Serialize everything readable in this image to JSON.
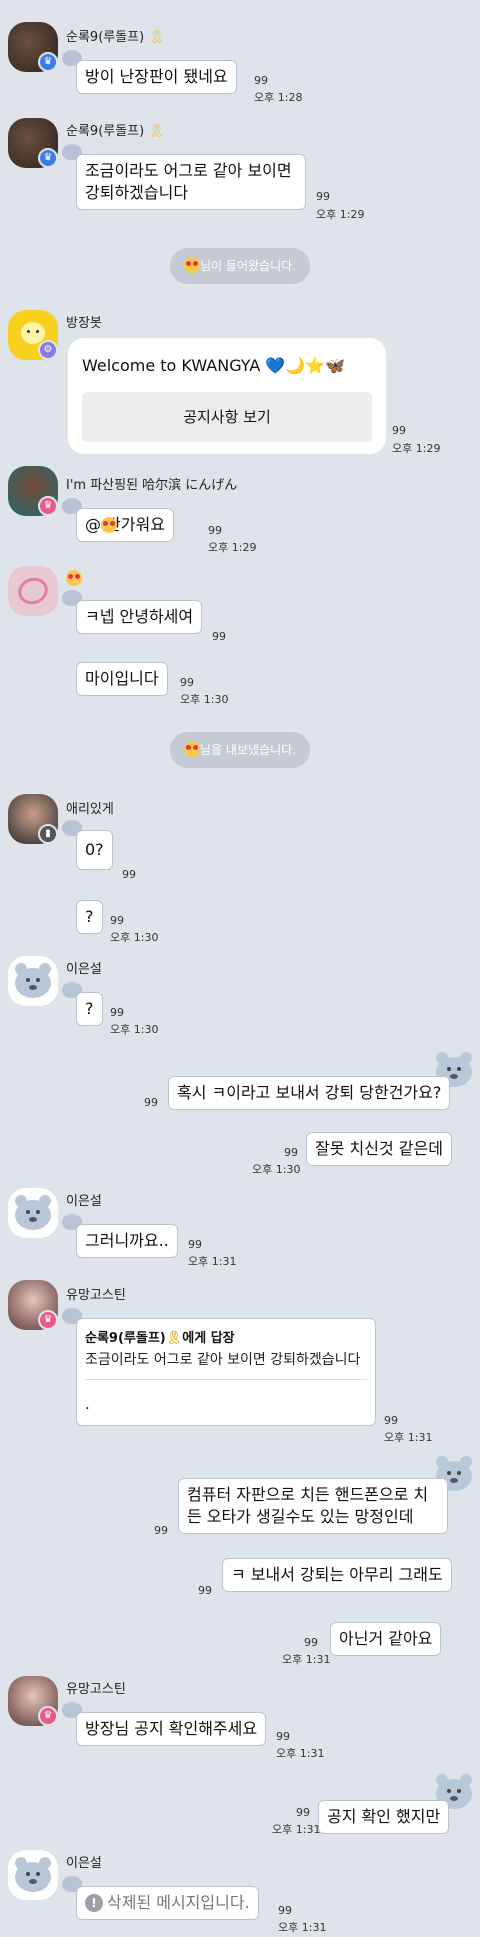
{
  "read_count": "99",
  "messages": {
    "m1": {
      "sender": "순록9(루돌프)",
      "text": "방이 난장판이 됐네요",
      "time": "오후 1:28"
    },
    "m2": {
      "sender": "순록9(루돌프)",
      "text": "조금이라도 어그로 같아 보이면 강퇴하겠습니다",
      "time": "오후 1:29"
    },
    "sys1": {
      "text": "님이 들어왔습니다."
    },
    "m3": {
      "sender": "방장봇",
      "text": "Welcome to KWANGYA 💙🌙⭐🦋",
      "button": "공지사항 보기",
      "time": "오후 1:29"
    },
    "m4": {
      "sender": "I'm 파산핑된 哈尔滨 にんげん",
      "text": "@ 반가워요",
      "time": "오후 1:29"
    },
    "m5": {
      "text": "ㅋ넵 안녕하세여"
    },
    "m6": {
      "text": "마이입니다",
      "time": "오후 1:30"
    },
    "sys2": {
      "text": "님을 내보냈습니다."
    },
    "m7": {
      "sender": "애리있게",
      "text": "0?"
    },
    "m8": {
      "text": "?",
      "time": "오후 1:30"
    },
    "m9": {
      "sender": "이은설",
      "text": "?",
      "time": "오후 1:30"
    },
    "m10": {
      "text": "혹시 ㅋ이라고 보내서 강퇴 당한건가요?"
    },
    "m11": {
      "text": "잘못 치신것 같은데",
      "time": "오후 1:30"
    },
    "m12": {
      "sender": "이은설",
      "text": "그러니까요..",
      "time": "오후 1:31"
    },
    "m13": {
      "sender": "유망고스틴",
      "reply_to": "순록9(루돌프)",
      "reply_suffix": "에게 답장",
      "quoted": "조금이라도 어그로 같아 보이면 강퇴하겠습니다",
      "text": ".",
      "time": "오후 1:31"
    },
    "m14": {
      "text": "컴퓨터 자판으로 치든 핸드폰으로 치든 오타가 생길수도 있는 망정인데"
    },
    "m15": {
      "text": "ㅋ 보내서 강퇴는 아무리 그래도"
    },
    "m16": {
      "text": "아닌거 같아요",
      "time": "오후 1:31"
    },
    "m17": {
      "sender": "유망고스틴",
      "text": "방장님 공지 확인해주세요",
      "time": "오후 1:31"
    },
    "m18": {
      "text": "공지 확인 했지만",
      "time": "오후 1:31"
    },
    "m19": {
      "sender": "이은설",
      "text": "삭제된 메시지입니다.",
      "time": "오후 1:31"
    }
  }
}
